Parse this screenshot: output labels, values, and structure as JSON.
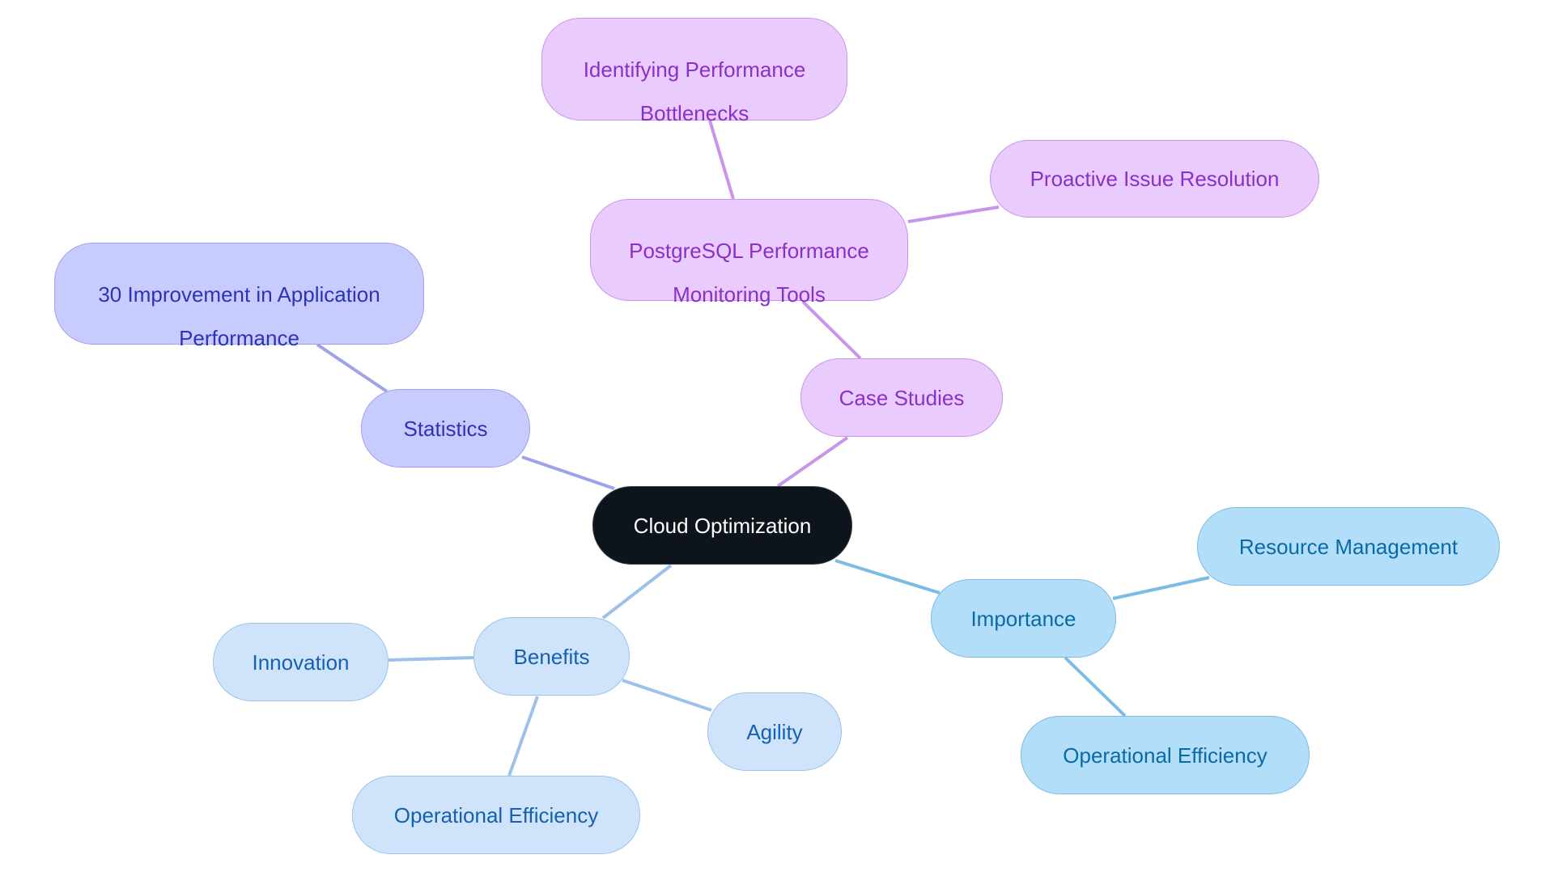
{
  "diagram": {
    "type": "mindmap",
    "root": {
      "id": "root",
      "label": "Cloud Optimization",
      "group": "root"
    },
    "nodes": [
      {
        "id": "root",
        "label": "Cloud Optimization",
        "group": "root"
      },
      {
        "id": "statistics",
        "label": "Statistics",
        "group": "indigo",
        "parent": "root"
      },
      {
        "id": "improvement",
        "label": "30 Improvement in Application Performance",
        "group": "indigo",
        "parent": "statistics"
      },
      {
        "id": "case-studies",
        "label": "Case Studies",
        "group": "purple",
        "parent": "root"
      },
      {
        "id": "postgres-tools",
        "label": "PostgreSQL Performance Monitoring Tools",
        "group": "purple",
        "parent": "case-studies"
      },
      {
        "id": "bottlenecks",
        "label": "Identifying Performance Bottlenecks",
        "group": "purple",
        "parent": "postgres-tools"
      },
      {
        "id": "proactive",
        "label": "Proactive Issue Resolution",
        "group": "purple",
        "parent": "postgres-tools"
      },
      {
        "id": "importance",
        "label": "Importance",
        "group": "sky",
        "parent": "root"
      },
      {
        "id": "resource-mgmt",
        "label": "Resource Management",
        "group": "sky",
        "parent": "importance"
      },
      {
        "id": "op-eff-importance",
        "label": "Operational Efficiency",
        "group": "sky",
        "parent": "importance"
      },
      {
        "id": "benefits",
        "label": "Benefits",
        "group": "light",
        "parent": "root"
      },
      {
        "id": "innovation",
        "label": "Innovation",
        "group": "light",
        "parent": "benefits"
      },
      {
        "id": "agility",
        "label": "Agility",
        "group": "light",
        "parent": "benefits"
      },
      {
        "id": "op-eff-benefits",
        "label": "Operational Efficiency",
        "group": "light",
        "parent": "benefits"
      }
    ],
    "labels": {
      "root": "Cloud Optimization",
      "statistics": "Statistics",
      "improvement_line1": "30 Improvement in Application",
      "improvement_line2": "Performance",
      "case_studies": "Case Studies",
      "postgres_line1": "PostgreSQL Performance",
      "postgres_line2": "Monitoring Tools",
      "bottlenecks_line1": "Identifying Performance",
      "bottlenecks_line2": "Bottlenecks",
      "proactive": "Proactive Issue Resolution",
      "importance": "Importance",
      "resource_mgmt": "Resource Management",
      "op_eff_importance": "Operational Efficiency",
      "benefits": "Benefits",
      "innovation": "Innovation",
      "agility": "Agility",
      "op_eff_benefits": "Operational Efficiency"
    },
    "colors": {
      "root_fill": "#0d141b",
      "root_text": "#ffffff",
      "purple_fill": "#e9ccfd",
      "purple_edge": "#c895e8",
      "purple_text": "#8b2fc9",
      "indigo_fill": "#c8cbfe",
      "indigo_edge": "#9ea2ec",
      "indigo_text": "#2c33b8",
      "sky_fill": "#b3def9",
      "sky_edge": "#7cbbe5",
      "sky_text": "#0a6aa8",
      "light_fill": "#cfe4fb",
      "light_edge": "#9cc2ea",
      "light_text": "#1560b0"
    }
  }
}
